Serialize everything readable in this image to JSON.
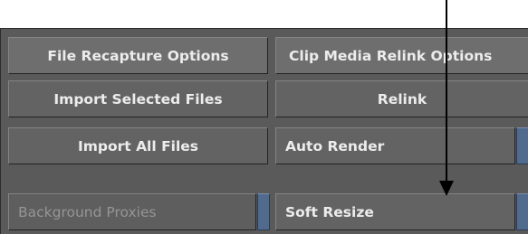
{
  "buttons": {
    "file_recapture_options": "File Recapture Options",
    "clip_media_relink_options": "Clip Media Relink Options",
    "import_selected_files": "Import Selected Files",
    "relink": "Relink",
    "import_all_files": "Import All Files",
    "auto_render": "Auto Render",
    "background_proxies": "Background Proxies",
    "soft_resize": "Soft Resize"
  },
  "colors": {
    "panel": "#5a5a5a",
    "button": "#636363",
    "header_button": "#6e6e6e",
    "toggle_indicator": "#516b8e",
    "text": "#ececec",
    "dim_text": "#959595",
    "arrow": "#000000"
  },
  "states": {
    "background_proxies_enabled": false
  }
}
